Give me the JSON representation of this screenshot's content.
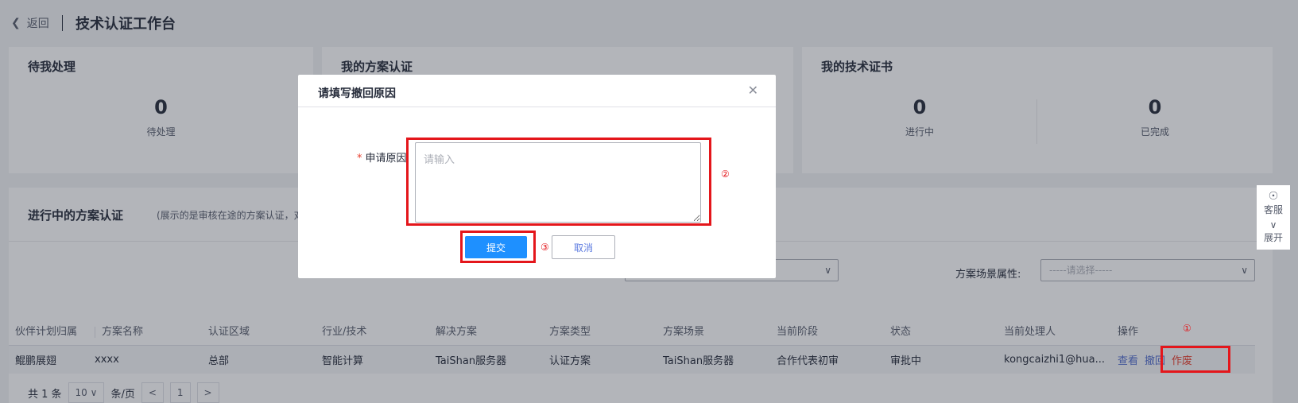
{
  "header": {
    "back_label": "返回",
    "title": "技术认证工作台"
  },
  "cards": {
    "pending": {
      "title": "待我处理",
      "count": "0",
      "label": "待处理"
    },
    "solution": {
      "title": "我的方案认证"
    },
    "cert": {
      "title": "我的技术证书",
      "in_progress_count": "0",
      "in_progress_label": "进行中",
      "done_count": "0",
      "done_label": "已完成"
    }
  },
  "section": {
    "title": "进行中的方案认证",
    "subtitle": "(展示的是审核在途的方案认证，对于"
  },
  "filters": {
    "scene_label": "方案场景属性:",
    "scene_placeholder": "-----请选择-----"
  },
  "table": {
    "headers": [
      "伙伴计划归属",
      "方案名称",
      "认证区域",
      "行业/技术",
      "解决方案",
      "方案类型",
      "方案场景",
      "当前阶段",
      "状态",
      "当前处理人",
      "操作"
    ],
    "rows": [
      [
        "鲲鹏展翅",
        "xxxx",
        "总部",
        "智能计算",
        "TaiShan服务器",
        "认证方案",
        "TaiShan服务器",
        "合作代表初审",
        "审批中",
        "kongcaizhi1@hua..."
      ]
    ],
    "actions": {
      "view": "查看",
      "withdraw": "撤回",
      "void": "作废"
    }
  },
  "pager": {
    "total": "共 1 条",
    "size": "10",
    "per_page": "条/页",
    "page": "1"
  },
  "side": {
    "service": "客服",
    "expand": "展开"
  },
  "modal": {
    "title": "请填写撤回原因",
    "field_label": "申请原因",
    "placeholder": "请输入",
    "submit": "提交",
    "cancel": "取消"
  },
  "annotations": {
    "one": "①",
    "two": "②",
    "three": "③"
  }
}
